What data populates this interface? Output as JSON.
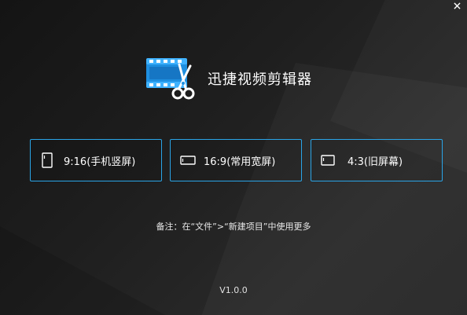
{
  "app": {
    "title": "迅捷视频剪辑器",
    "version": "V1.0.0"
  },
  "window_controls": {
    "close_icon": "close-icon"
  },
  "aspect_options": [
    {
      "label": "9:16(手机竖屏)",
      "icon": "portrait-frame-icon"
    },
    {
      "label": "16:9(常用宽屏)",
      "icon": "widescreen-frame-icon"
    },
    {
      "label": "4:3(旧屏幕)",
      "icon": "standard-frame-icon"
    }
  ],
  "footnote": "备注：在“文件”>“新建项目”中使用更多",
  "colors": {
    "accent": "#2aa5e8",
    "background": "#1f1f1f",
    "text": "#ffffff"
  }
}
